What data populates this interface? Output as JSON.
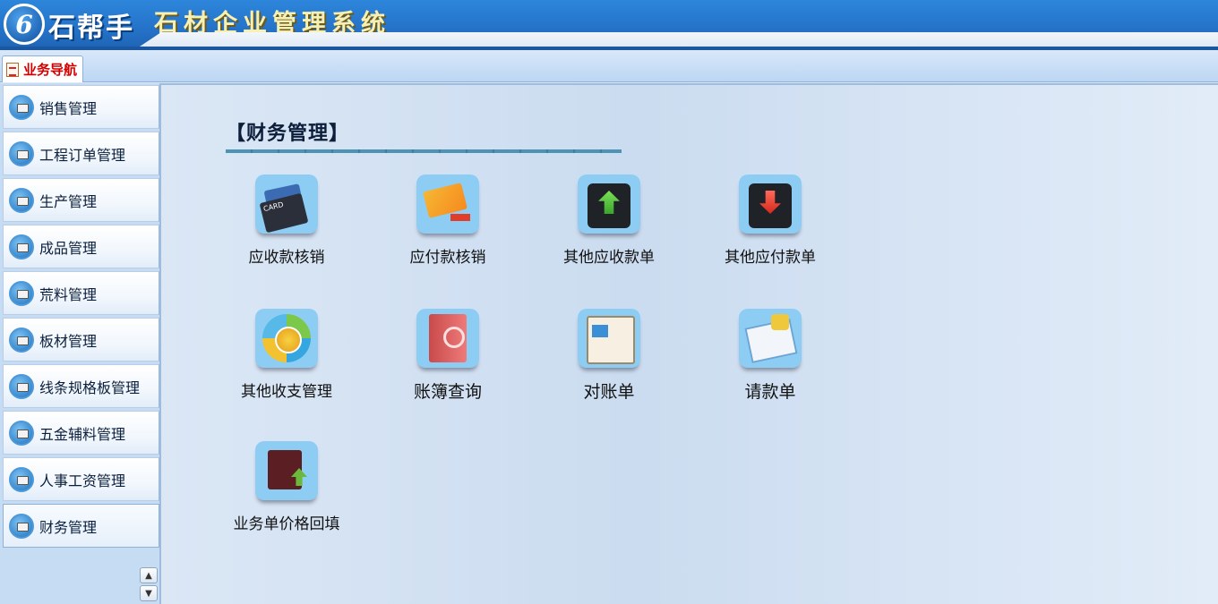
{
  "header": {
    "logo_mark": "6",
    "brand": "石帮手",
    "system_title": "石材企业管理系统"
  },
  "tabs": [
    {
      "label": "业务导航",
      "icon": "document-edit-icon"
    }
  ],
  "sidebar": {
    "items": [
      {
        "label": "销售管理",
        "icon": "sales-icon"
      },
      {
        "label": "工程订单管理",
        "icon": "project-order-icon"
      },
      {
        "label": "生产管理",
        "icon": "production-icon"
      },
      {
        "label": "成品管理",
        "icon": "finished-goods-icon"
      },
      {
        "label": "荒料管理",
        "icon": "raw-block-icon"
      },
      {
        "label": "板材管理",
        "icon": "slab-icon"
      },
      {
        "label": "线条规格板管理",
        "icon": "strip-board-icon"
      },
      {
        "label": "五金辅料管理",
        "icon": "hardware-icon"
      },
      {
        "label": "人事工资管理",
        "icon": "hr-salary-icon"
      },
      {
        "label": "财务管理",
        "icon": "finance-icon"
      }
    ],
    "scroll_up": "▲",
    "scroll_down": "▼"
  },
  "main": {
    "section_title": "【财务管理】",
    "tiles": [
      {
        "label": "应收款核销",
        "icon": "receivable-card-icon"
      },
      {
        "label": "应付款核销",
        "icon": "payable-card-icon"
      },
      {
        "label": "其他应收款单",
        "icon": "atm-receive-icon"
      },
      {
        "label": "其他应付款单",
        "icon": "atm-pay-icon"
      },
      {
        "label": "其他收支管理",
        "icon": "income-expense-icon"
      },
      {
        "label": "账簿查询",
        "icon": "ledger-book-icon"
      },
      {
        "label": "对账单",
        "icon": "statement-icon"
      },
      {
        "label": "请款单",
        "icon": "payment-request-icon"
      },
      {
        "label": "业务单价格回填",
        "icon": "price-backfill-icon"
      }
    ]
  }
}
